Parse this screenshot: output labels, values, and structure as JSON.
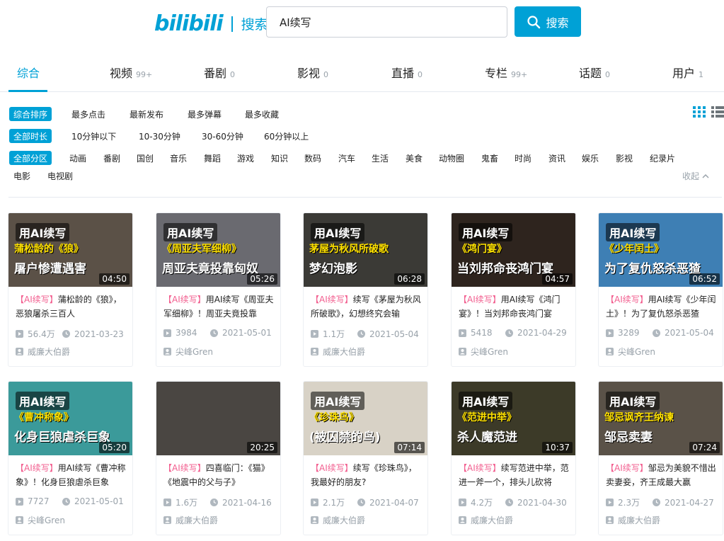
{
  "header": {
    "logo_text": "bilibili",
    "logo_sub": "搜索",
    "search_value": "AI续写",
    "search_button": "搜索"
  },
  "tabs": [
    {
      "label": "综合",
      "count": ""
    },
    {
      "label": "视频",
      "count": "99+"
    },
    {
      "label": "番剧",
      "count": "0"
    },
    {
      "label": "影视",
      "count": "0"
    },
    {
      "label": "直播",
      "count": "0"
    },
    {
      "label": "专栏",
      "count": "99+"
    },
    {
      "label": "话题",
      "count": "0"
    },
    {
      "label": "用户",
      "count": "1"
    }
  ],
  "filters": {
    "sort": {
      "chip": "综合排序",
      "items": [
        "最多点击",
        "最新发布",
        "最多弹幕",
        "最多收藏"
      ]
    },
    "duration": {
      "chip": "全部时长",
      "items": [
        "10分钟以下",
        "10-30分钟",
        "30-60分钟",
        "60分钟以上"
      ]
    },
    "zone": {
      "chip": "全部分区",
      "items": [
        "动画",
        "番剧",
        "国创",
        "音乐",
        "舞蹈",
        "游戏",
        "知识",
        "数码",
        "汽车",
        "生活",
        "美食",
        "动物圈",
        "鬼畜",
        "时尚",
        "资讯",
        "娱乐",
        "影视",
        "纪录片"
      ],
      "items2": [
        "电影",
        "电视剧"
      ]
    },
    "collapse": "收起"
  },
  "colors": {
    "accent": "#00a1d6",
    "keyword": "#f25d8e",
    "meta": "#99a2aa"
  },
  "videos": [
    {
      "thumb": [
        "用AI续写",
        "蒲松龄的《狼》",
        "屠户惨遭遇害"
      ],
      "duration": "04:50",
      "title_kw": "【AI续写】",
      "title_rest": "蒲松龄的《狼》，恶狼屠杀三百人",
      "plays": "56.4万",
      "date": "2021-03-23",
      "author": "威廉大伯爵",
      "bg": "#5b5147"
    },
    {
      "thumb": [
        "用AI续写",
        "《周亚夫军细柳》",
        "周亚夫竟投靠匈奴"
      ],
      "duration": "05:26",
      "title_kw": "【AI续写】",
      "title_rest": "用AI续写《周亚夫军细柳》！周亚夫竟投靠",
      "plays": "3984",
      "date": "2021-05-01",
      "author": "尖峰Gren",
      "bg": "#6a6a70"
    },
    {
      "thumb": [
        "用AI续写",
        "茅屋为秋风所破歌",
        "梦幻泡影"
      ],
      "duration": "06:28",
      "title_kw": "【AI续写】",
      "title_rest": "续写《茅屋为秋风所破歌》，幻想终究会输",
      "plays": "1.1万",
      "date": "2021-05-04",
      "author": "威廉大伯爵",
      "bg": "#3b3a36"
    },
    {
      "thumb": [
        "用AI续写",
        "《鸿门宴》",
        "当刘邦命丧鸿门宴"
      ],
      "duration": "04:57",
      "title_kw": "【AI续写】",
      "title_rest": "用AI续写《鸿门宴》！当刘邦命丧鸿门宴",
      "plays": "5418",
      "date": "2021-04-29",
      "author": "尖峰Gren",
      "bg": "#2e241e"
    },
    {
      "thumb": [
        "用AI续写",
        "《少年闰土》",
        "为了复仇怒杀恶猹"
      ],
      "duration": "06:52",
      "title_kw": "【AI续写】",
      "title_rest": "用AI续写《少年闰土》！为了复仇怒杀恶猹",
      "plays": "3289",
      "date": "2021-05-04",
      "author": "尖峰Gren",
      "bg": "#3e7fb4"
    },
    {
      "thumb": [
        "用AI续写",
        "《曹冲称象》",
        "化身巨狼虐杀巨象"
      ],
      "duration": "05:20",
      "title_kw": "【AI续写】",
      "title_rest": "用AI续写《曹冲称象》！化身巨狼虐杀巨象",
      "plays": "7727",
      "date": "2021-05-01",
      "author": "尖峰Gren",
      "bg": "#3b9a9a"
    },
    {
      "thumb": [
        "",
        "",
        ""
      ],
      "duration": "20:25",
      "title_kw": "【AI续写】",
      "title_rest": "四喜临门：《猫》《地震中的父与子》",
      "plays": "1.6万",
      "date": "2021-04-16",
      "author": "威廉大伯爵",
      "bg": "#4a4642"
    },
    {
      "thumb": [
        "用AI续写",
        "《珍珠鸟》",
        "(被囚禁的鸟)"
      ],
      "duration": "07:14",
      "title_kw": "【AI续写】",
      "title_rest": "续写《珍珠鸟》，我最好的朋友?",
      "plays": "2.1万",
      "date": "2021-04-07",
      "author": "威廉大伯爵",
      "bg": "#d8d2c6"
    },
    {
      "thumb": [
        "用AI续写",
        "《范进中举》",
        "杀人魔范进"
      ],
      "duration": "10:37",
      "title_kw": "【AI续写】",
      "title_rest": "续写范进中举，范进一斧一个，排头儿砍将",
      "plays": "4.2万",
      "date": "2021-04-30",
      "author": "威廉大伯爵",
      "bg": "#3c3a28"
    },
    {
      "thumb": [
        "用AI续写",
        "邹忌讽齐王纳谏",
        "邹忌卖妻"
      ],
      "duration": "07:24",
      "title_kw": "【AI续写】",
      "title_rest": "邹忌为美貌不惜出卖妻妾，齐王成最大赢",
      "plays": "2.3万",
      "date": "2021-04-27",
      "author": "威廉大伯爵",
      "bg": "#5a5248"
    }
  ]
}
